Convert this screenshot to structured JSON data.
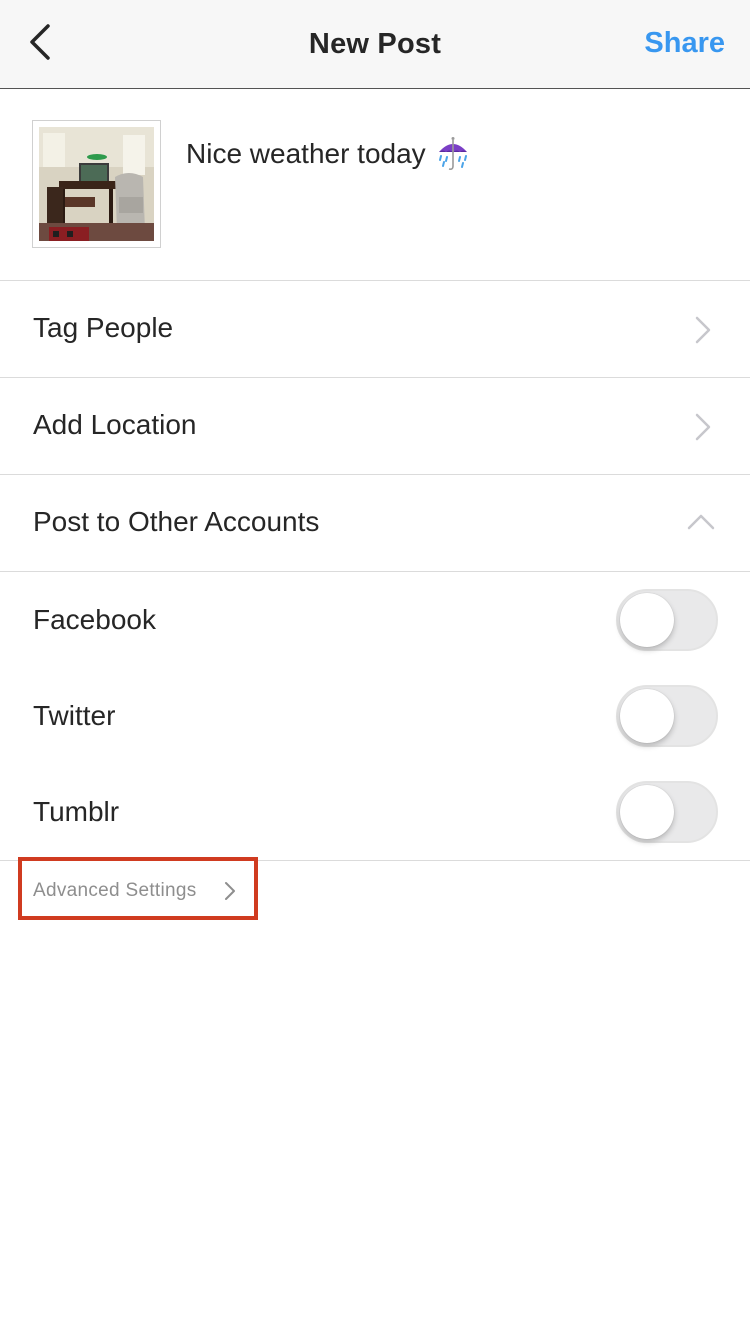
{
  "header": {
    "title": "New Post",
    "share_label": "Share",
    "back_icon": "chevron-left-icon"
  },
  "post": {
    "caption": "Nice weather today",
    "caption_emoji": "umbrella-with-rain-icon",
    "thumbnail": "room-photo"
  },
  "menu": {
    "tag_people": "Tag People",
    "add_location": "Add Location",
    "post_to_other": "Post to Other Accounts"
  },
  "accounts": [
    {
      "label": "Facebook",
      "enabled": false
    },
    {
      "label": "Twitter",
      "enabled": false
    },
    {
      "label": "Tumblr",
      "enabled": false
    }
  ],
  "advanced": {
    "label": "Advanced Settings"
  },
  "colors": {
    "accent": "#3897f0",
    "highlight_box": "#d03b20",
    "toggle_off": "#e9e9ea"
  }
}
